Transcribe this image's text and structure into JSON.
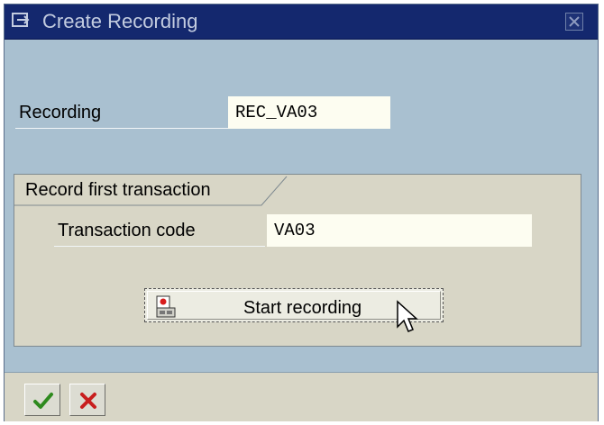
{
  "window": {
    "title": "Create Recording"
  },
  "form": {
    "recording_label": "Recording",
    "recording_value": "REC_VA03"
  },
  "group": {
    "title": "Record first transaction",
    "tcode_label": "Transaction code",
    "tcode_value": "VA03",
    "start_button_label": "Start recording"
  },
  "icons": {
    "title": "dialog-window-icon",
    "close": "close-icon",
    "record": "recording-icon",
    "ok": "checkmark-icon",
    "cancel": "cancel-x-icon",
    "cursor": "mouse-pointer-icon"
  },
  "colors": {
    "titlebar": "#14286e",
    "window_bg": "#a9c0d0",
    "group_bg": "#d8d6c6",
    "input_bg": "#fdfdf1",
    "ok_green": "#2e8a1e",
    "cancel_red": "#c81e1e"
  }
}
